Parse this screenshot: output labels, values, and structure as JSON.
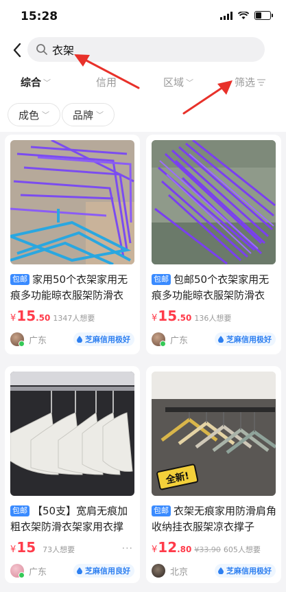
{
  "status_bar": {
    "time": "15:28"
  },
  "search": {
    "query": "衣架"
  },
  "filters": [
    {
      "label": "综合",
      "active": true
    },
    {
      "label": "信用"
    },
    {
      "label": "区域"
    },
    {
      "label": "筛选"
    }
  ],
  "chips": [
    "成色",
    "品牌"
  ],
  "products": [
    {
      "tag": "包邮",
      "title": "家用50个衣架家用无痕多功能晾衣服架防滑衣",
      "currency": "¥",
      "price_int": "15",
      "price_dec": ".50",
      "wants": "1347人想要",
      "location": "广东",
      "credit": "芝麻信用极好"
    },
    {
      "tag": "包邮",
      "title": "包邮50个衣架家用无痕多功能晾衣服架防滑衣",
      "currency": "¥",
      "price_int": "15",
      "price_dec": ".50",
      "wants": "136人想要",
      "location": "广东",
      "credit": "芝麻信用极好"
    },
    {
      "tag": "包邮",
      "title": "【50支】宽肩无痕加粗衣架防滑衣架家用衣撑",
      "currency": "¥",
      "price_int": "15",
      "price_dec": "",
      "wants": "73人想要",
      "location": "广东",
      "credit": "芝麻信用良好",
      "more": "···"
    },
    {
      "tag": "包邮",
      "title": "衣架无痕家用防滑肩角收纳挂衣服架凉衣撑子",
      "currency": "¥",
      "price_int": "12",
      "price_dec": ".80",
      "original_price": "¥33.90",
      "wants": "605人想要",
      "location": "北京",
      "credit": "芝麻信用极好",
      "image_sticker": "全新!"
    }
  ],
  "colors": {
    "price": "#ff3b4a",
    "tag": "#3a8bff",
    "credit": "#2d7ff0",
    "annotation_arrow": "#e8312a"
  }
}
